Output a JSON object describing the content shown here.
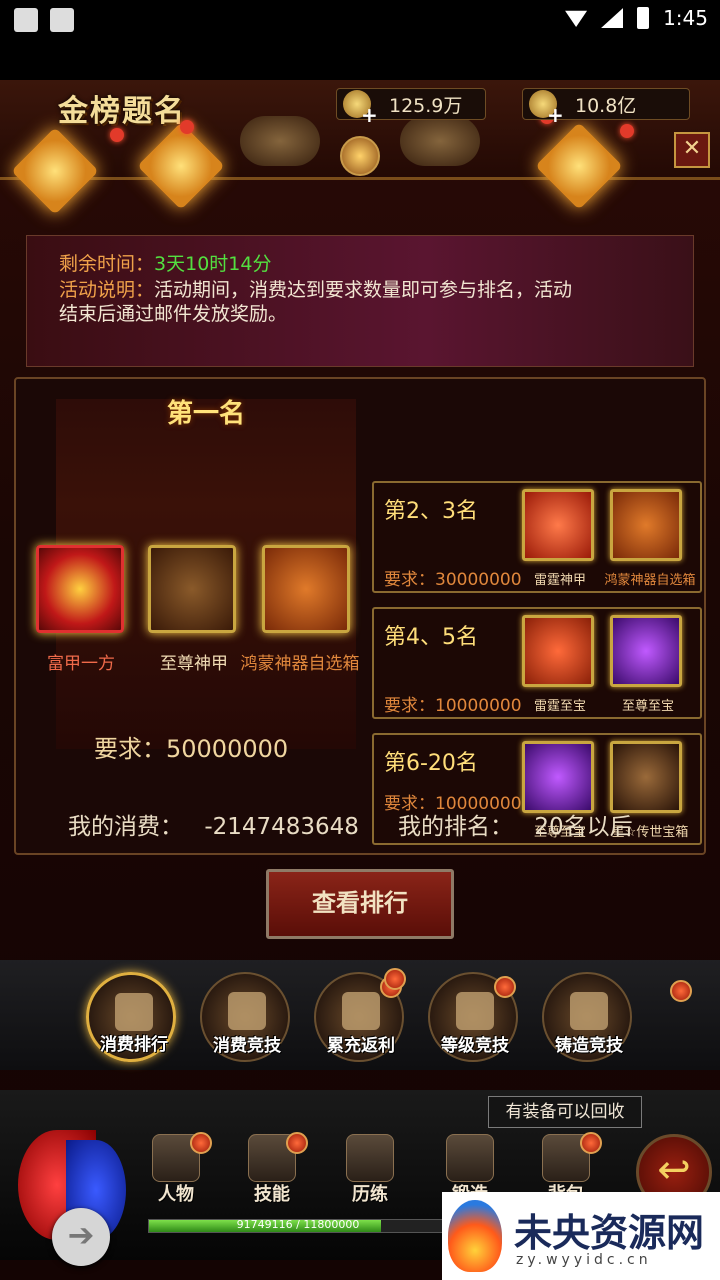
{
  "status_bar": {
    "time": "1:45"
  },
  "header": {
    "title": "金榜题名",
    "currency_1": "125.9万",
    "currency_2": "10.8亿",
    "close": "✕"
  },
  "info": {
    "time_label": "剩余时间：",
    "time_value": "3天10时14分",
    "desc_label": "活动说明：",
    "desc_line1": "活动期间，消费达到要求数量即可参与排名，活动",
    "desc_line2": "结束后通过邮件发放奖励。"
  },
  "first_place": {
    "title": "第一名",
    "items": [
      "富甲一方",
      "至尊神甲",
      "鸿蒙神器自选箱"
    ],
    "requirement": "要求：50000000"
  },
  "ranks": [
    {
      "title": "第2、3名",
      "requirement": "要求：30000000",
      "items": [
        "雷霆神甲",
        "鸿蒙神器自选箱"
      ]
    },
    {
      "title": "第4、5名",
      "requirement": "要求：10000000",
      "items": [
        "雷霆至宝",
        "至尊至宝"
      ]
    },
    {
      "title": "第6-20名",
      "requirement": "要求：10000000",
      "items": [
        "至尊至宝",
        "星☆传世宝箱"
      ]
    }
  ],
  "my_stats": {
    "spend_label": "我的消费：",
    "spend_value": "-2147483648",
    "rank_label": "我的排名：",
    "rank_value": "20名以后"
  },
  "view_rank_button": "查看排行",
  "tabs": [
    "消费排行",
    "消费竞技",
    "累充返利",
    "等级竞技",
    "铸造竞技"
  ],
  "recycle_tip": "有装备可以回收",
  "bottom_nav": [
    "人物",
    "技能",
    "历练",
    "锻造",
    "背包"
  ],
  "exp": {
    "text": "91749116 / 11800000",
    "fraction": 0.78
  },
  "watermark": {
    "title": "未央资源网",
    "url": "zy.wyyidc.cn"
  },
  "colors": {
    "accent_gold": "#ffde7a",
    "time_green": "#53e040",
    "label_orange": "#f0a24a"
  }
}
